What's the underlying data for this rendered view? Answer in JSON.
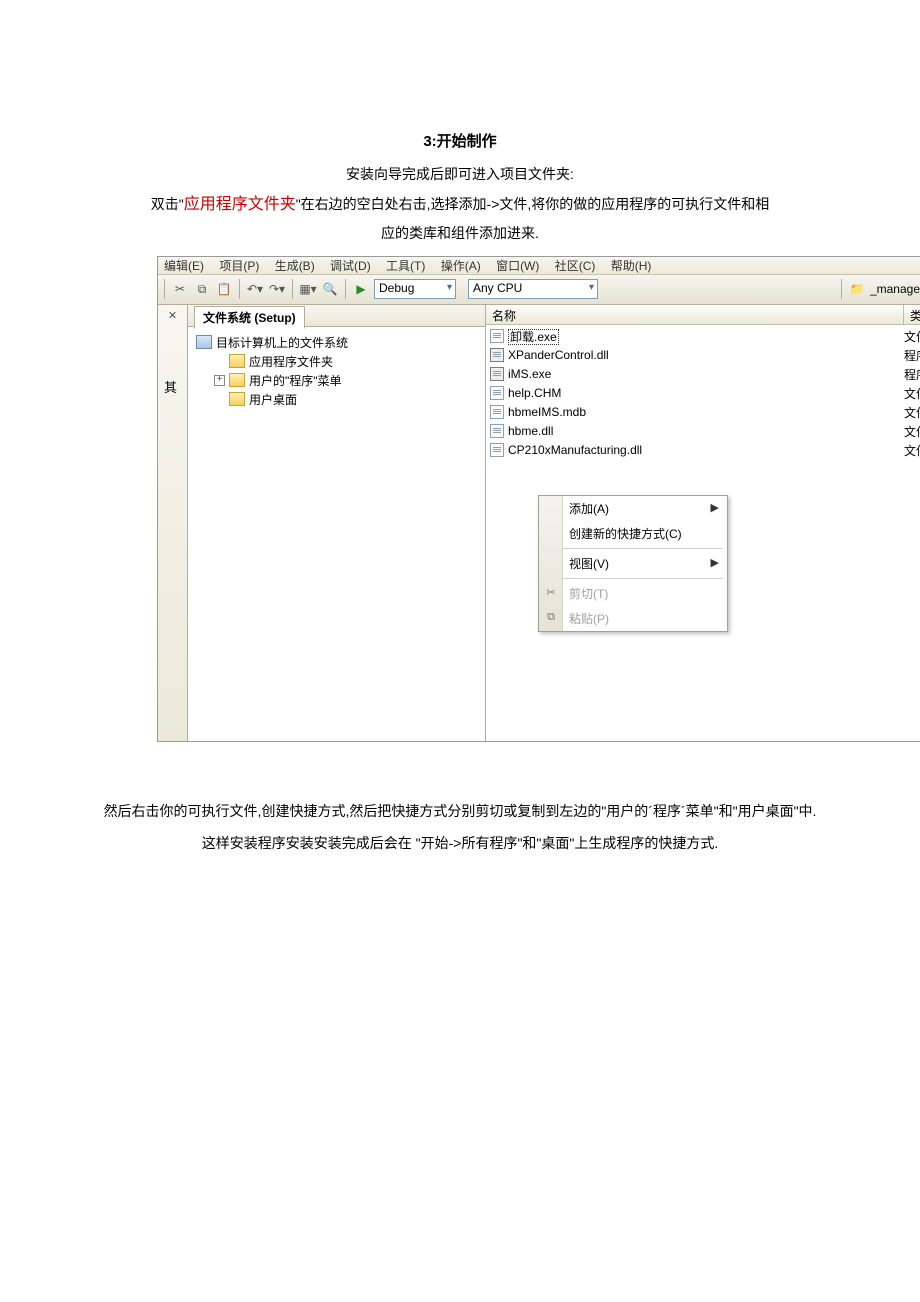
{
  "doc": {
    "title": "3:开始制作",
    "line1": "安装向导完成后即可进入项目文件夹:",
    "line2_pre": "双击\"",
    "line2_hl": "应用程序文件夹",
    "line2_post": "\"在右边的空白处右击,选择添加->文件,将你的做的应用程序的可执行文件和相",
    "line3": "应的类库和组件添加进来.",
    "para1": "然后右击你的可执行文件,创建快捷方式,然后把快捷方式分别剪切或复制到左边的\"用户的´程序´菜单\"和\"用户桌面\"中.",
    "para2": "这样安装程序安装安装完成后会在 \"开始->所有程序\"和\"桌面\"上生成程序的快捷方式."
  },
  "menubar": {
    "items": [
      "编辑(E)",
      "项目(P)",
      "生成(B)",
      "调试(D)",
      "工具(T)",
      "操作(A)",
      "窗口(W)",
      "社区(C)",
      "帮助(H)"
    ]
  },
  "toolbar": {
    "config": "Debug",
    "platform": "Any CPU",
    "project": "_manager"
  },
  "gutter": {
    "label": "其"
  },
  "tab": {
    "label": "文件系统 (Setup)"
  },
  "tree": {
    "root": "目标计算机上的文件系统",
    "nodes": [
      {
        "label": "应用程序文件夹",
        "expandable": false
      },
      {
        "label": "用户的\"程序\"菜单",
        "expandable": true
      },
      {
        "label": "用户桌面",
        "expandable": false
      }
    ]
  },
  "grid": {
    "col_name": "名称",
    "col_type": "类",
    "rows": [
      {
        "name": "卸载.exe",
        "type": "文件",
        "icon": "doc",
        "selected": true
      },
      {
        "name": "XPanderControl.dll",
        "type": "程序",
        "icon": "dll"
      },
      {
        "name": "iMS.exe",
        "type": "程序",
        "icon": "dll"
      },
      {
        "name": "help.CHM",
        "type": "文件",
        "icon": "doc"
      },
      {
        "name": "hbmeIMS.mdb",
        "type": "文件",
        "icon": "doc"
      },
      {
        "name": "hbme.dll",
        "type": "文件",
        "icon": "doc"
      },
      {
        "name": "CP210xManufacturing.dll",
        "type": "文件",
        "icon": "doc"
      }
    ]
  },
  "contextmenu": {
    "add": "添加(A)",
    "shortcut": "创建新的快捷方式(C)",
    "view": "视图(V)",
    "cut": "剪切(T)",
    "paste": "粘贴(P)"
  }
}
